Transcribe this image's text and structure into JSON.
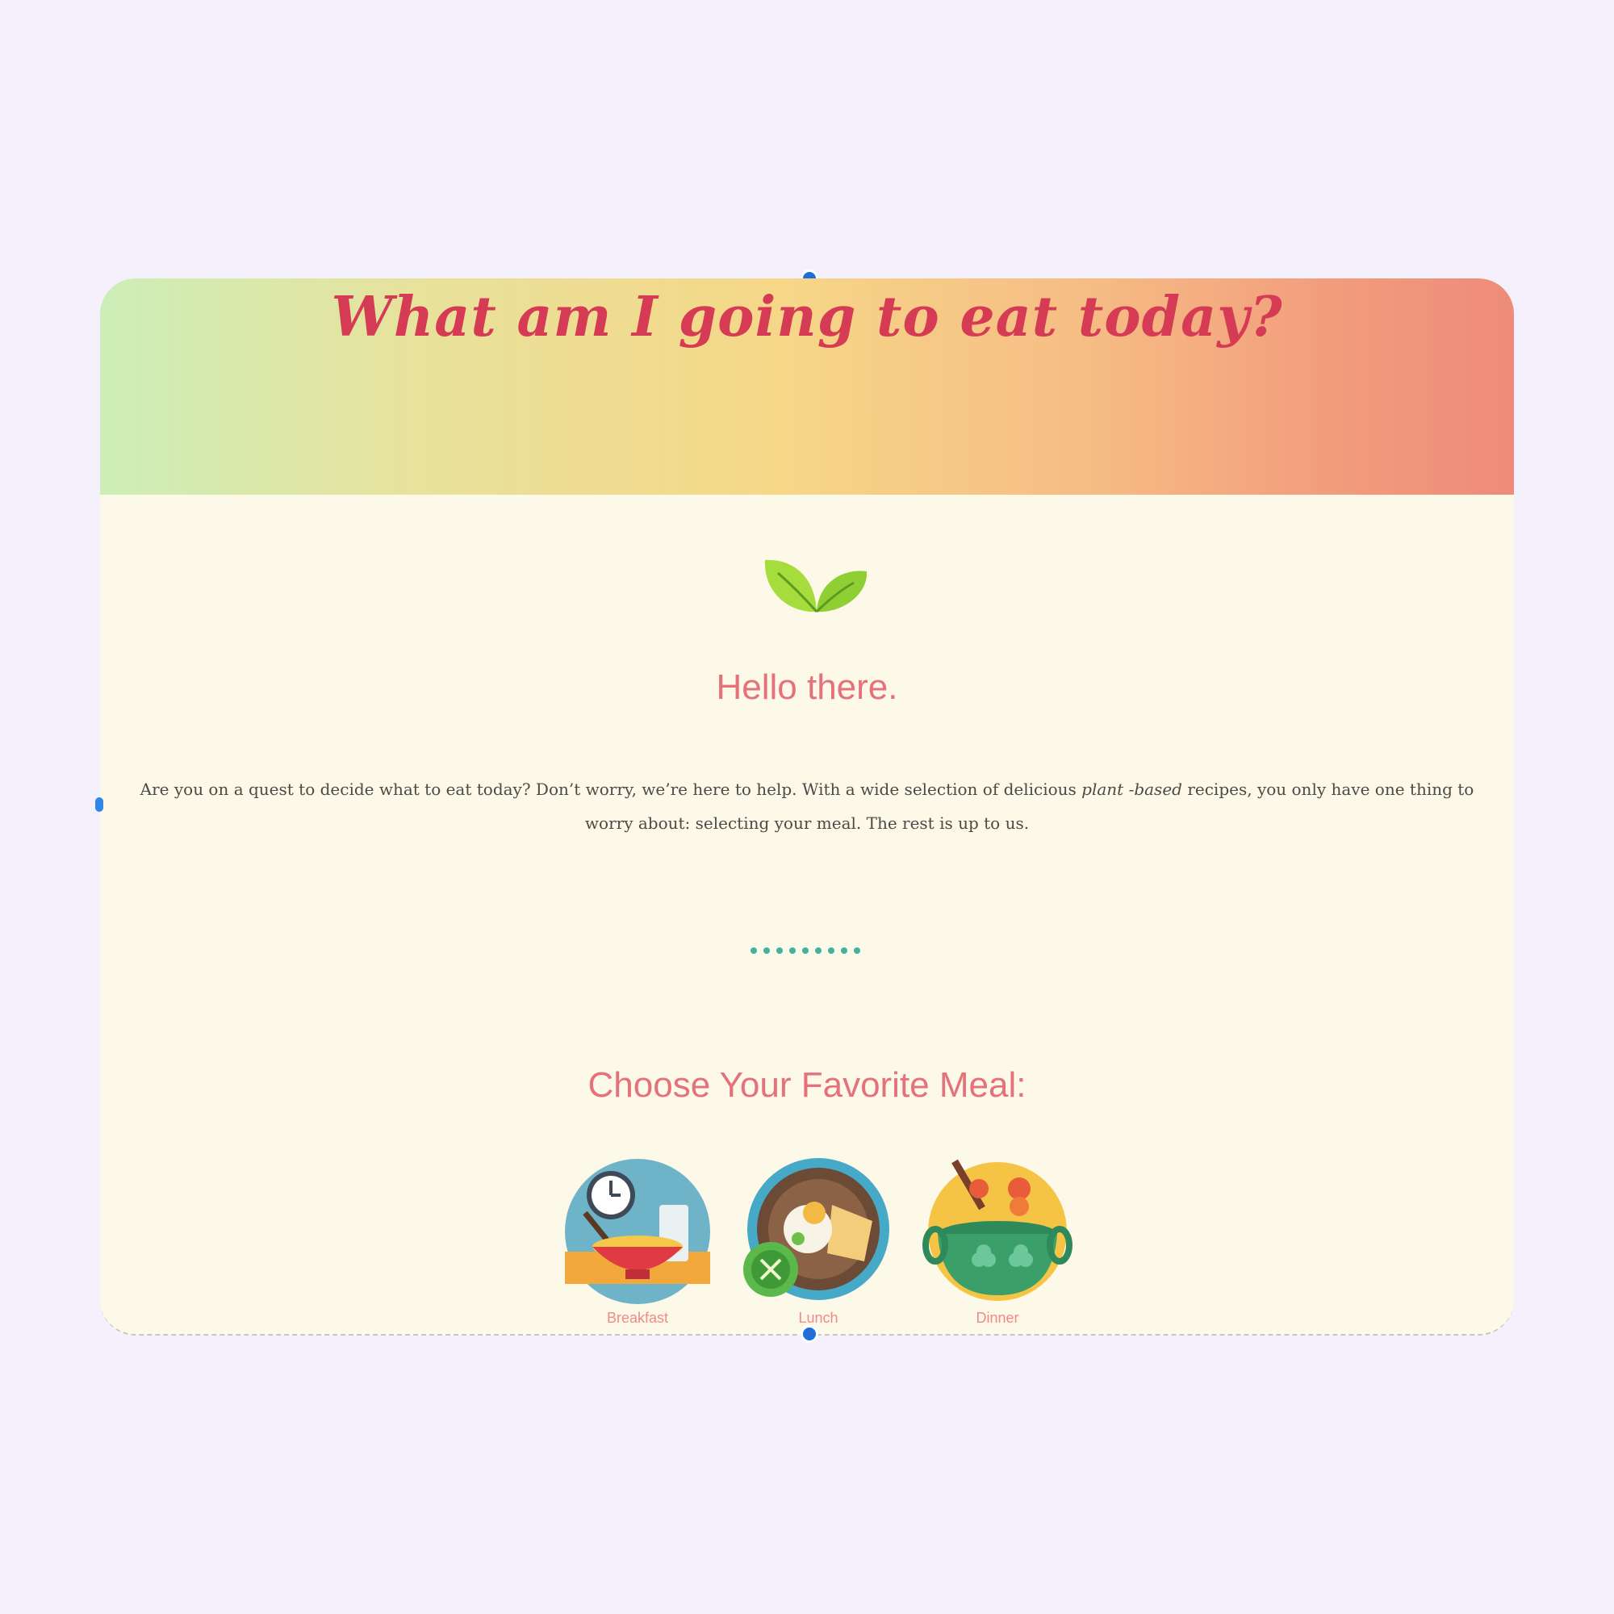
{
  "page": {
    "title": "What am I going to eat today?",
    "greeting": "Hello there.",
    "intro": {
      "part1": "Are you on a quest to decide what to eat today? Don’t worry, we’re here to help. With a wide selection of delicious ",
      "emphasis": "plant -based",
      "part2": " recipes, you only have one thing to worry about: selecting your meal. The rest is up to us."
    },
    "choose_heading": "Choose Your Favorite Meal:",
    "meals": [
      {
        "label": "Breakfast",
        "icon": "breakfast-bowl-icon"
      },
      {
        "label": "Lunch",
        "icon": "lunch-plate-icon"
      },
      {
        "label": "Dinner",
        "icon": "dinner-pot-icon"
      }
    ]
  },
  "colors": {
    "title": "#d63b55",
    "heading": "#e5717a",
    "dots": "#3db4a3",
    "leaf": "#9ad83a",
    "card_bg": "#fcf9e8",
    "page_bg": "#f4f1fc"
  }
}
